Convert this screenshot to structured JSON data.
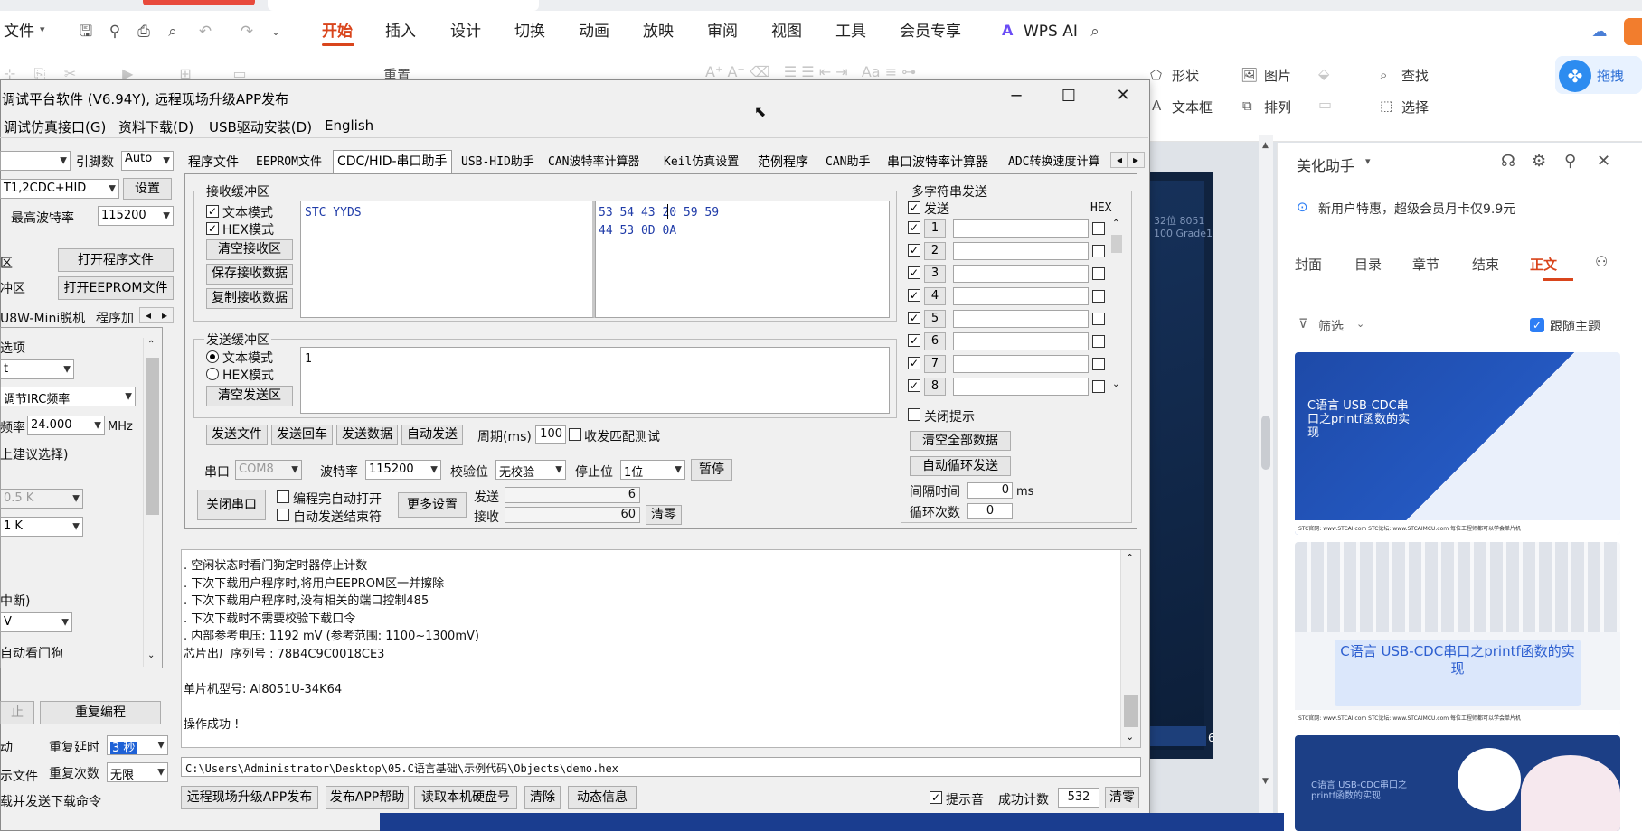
{
  "wps": {
    "menu": [
      "文件",
      "开始",
      "插入",
      "设计",
      "切换",
      "动画",
      "放映",
      "审阅",
      "视图",
      "工具",
      "会员专享",
      "WPS AI"
    ],
    "active_menu": "开始",
    "ribbon": {
      "shape": "形状",
      "picture": "图片",
      "find": "查找",
      "textbox": "文本框",
      "arrange": "排列",
      "select": "选择",
      "repeat": "重置",
      "drag_btn": "拖拽"
    },
    "slide_number": "6",
    "slide_text": "32位 8051\n100 Grade1"
  },
  "assistant": {
    "title": "美化助手",
    "promo": "新用户特惠，超级会员月卡仅9.9元",
    "tabs": [
      "封面",
      "目录",
      "章节",
      "结束",
      "正文"
    ],
    "active_tab": "正文",
    "filter": "筛选",
    "follow_theme": "跟随主题",
    "thumb1_text": "C语言 USB-CDC串口之printf函数的实现",
    "thumb2_text": "C语言 USB-CDC串口之printf函数的实现",
    "thumb3_text": "C语言 USB-CDC串口之printf函数的实现",
    "thumb_footer": "STC官网: www.STCAI.com   STC论坛: www.STCAIMCU.com   每位工程师都可以学会单片机"
  },
  "stc": {
    "title": "调试平台软件 (V6.94Y), 远程现场升级APP发布",
    "menu": [
      "调试仿真接口(G)",
      "资料下载(D)",
      "USB驱动安装(D)",
      "English"
    ],
    "left": {
      "pin_label": "引脚数",
      "pin_value": "Auto",
      "port_value": "T1,2CDC+HID",
      "settings_btn": "设置",
      "max_baud_label": "最高波特率",
      "max_baud_value": "115200",
      "area1": "区",
      "area2": "冲区",
      "open_prog": "打开程序文件",
      "open_eeprom": "打开EEPROM文件",
      "tab1": "U8W-Mini脱机",
      "tab2": "程序加",
      "options": "选项",
      "combo1": "t",
      "irc_combo": "调节IRC频率",
      "freq_label": "频率",
      "freq_value": "24.000",
      "freq_unit": "MHz",
      "suggest": "上建议选择)",
      "combo_05k": "0.5 K",
      "combo_1k": "1   K",
      "interrupt": "中断)",
      "combo_v": "V",
      "watchdog": "自动看门狗",
      "btn_partial": "止",
      "reprogram": "重复编程",
      "auto_label": "动",
      "repeat_delay_label": "重复延时",
      "repeat_delay_value": "3 秒",
      "file_label": "示文件",
      "repeat_count_label": "重复次数",
      "repeat_count_value": "无限",
      "send_cmd": "载并发送下载命令"
    },
    "tabs": [
      "程序文件",
      "EEPROM文件",
      "CDC/HID-串口助手",
      "USB-HID助手",
      "CAN波特率计算器",
      "Keil仿真设置",
      "范例程序",
      "CAN助手",
      "串口波特率计算器",
      "ADC转换速度计算"
    ],
    "active_tab": "CDC/HID-串口助手",
    "rx": {
      "group": "接收缓冲区",
      "text_mode": "文本模式",
      "hex_mode": "HEX模式",
      "clear": "清空接收区",
      "save": "保存接收数据",
      "copy": "复制接收数据",
      "text_content": "STC YYDS",
      "hex_line1": "53 54 43 20 59 59",
      "hex_line2": "44 53 0D 0A"
    },
    "tx": {
      "group": "发送缓冲区",
      "text_mode": "文本模式",
      "hex_mode": "HEX模式",
      "clear": "清空发送区",
      "content": "1",
      "send_file": "发送文件",
      "send_return": "发送回车",
      "send_data": "发送数据",
      "auto_send": "自动发送",
      "period_label": "周期(ms)",
      "period_value": "100",
      "match_test": "收发匹配测试"
    },
    "serial": {
      "port_label": "串口",
      "port_value": "COM8",
      "baud_label": "波特率",
      "baud_value": "115200",
      "parity_label": "校验位",
      "parity_value": "无校验",
      "stop_label": "停止位",
      "stop_value": "1位",
      "pause": "暂停",
      "close_port": "关闭串口",
      "auto_open": "编程完自动打开",
      "auto_send_end": "自动发送结束符",
      "more": "更多设置",
      "sent_label": "发送",
      "sent_value": "6",
      "recv_label": "接收",
      "recv_value": "60",
      "clear": "清零"
    },
    "multi": {
      "group": "多字符串发送",
      "send_header": "发送",
      "hex_header": "HEX",
      "rows": [
        "1",
        "2",
        "3",
        "4",
        "5",
        "6",
        "7",
        "8"
      ],
      "close_hint": "关闭提示",
      "clear_all": "清空全部数据",
      "auto_loop": "自动循环发送",
      "interval_label": "间隔时间",
      "interval_value": "0",
      "interval_unit": "ms",
      "loop_label": "循环次数",
      "loop_value": "0"
    },
    "log": [
      ".  空闲状态时看门狗定时器停止计数",
      ".  下次下载用户程序时,将用户EEPROM区一并擦除",
      ".  下次下载用户程序时,没有相关的端口控制485",
      ".  下次下载时不需要校验下载口令",
      ".  内部参考电压: 1192 mV (参考范围: 1100~1300mV)",
      "芯片出厂序列号 : 78B4C9C0018CE3",
      "",
      "  单片机型号: AI8051U-34K64",
      "",
      "操作成功 !"
    ],
    "path": "C:\\Users\\Administrator\\Desktop\\05.C语言基础\\示例代码\\Objects\\demo.hex",
    "bottom": {
      "remote_upgrade": "远程现场升级APP发布",
      "publish_help": "发布APP帮助",
      "read_disk": "读取本机硬盘号",
      "clear": "清除",
      "dynamic": "动态信息",
      "beep": "提示音",
      "success_label": "成功计数",
      "success_value": "532",
      "reset": "清零"
    }
  }
}
